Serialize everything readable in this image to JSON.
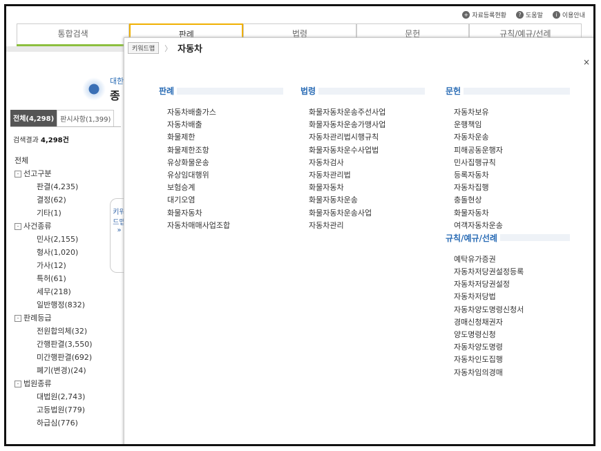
{
  "header": {
    "links": [
      "자료등록현황",
      "도움말",
      "이용안내"
    ]
  },
  "tabs": [
    "통합검색",
    "판례",
    "법령",
    "문헌",
    "규칙/예규/선례"
  ],
  "logo": {
    "line1": "대한",
    "line2": "종"
  },
  "left": {
    "tabs": [
      "전체(4,298)",
      "판시사항(1,399)"
    ],
    "result_label": "검색결과",
    "result_count": "4,298건",
    "tree": [
      {
        "label": "전체",
        "level": 0,
        "toggle": ""
      },
      {
        "label": "선고구분",
        "level": 1,
        "toggle": "-"
      },
      {
        "label": "판결(4,235)",
        "level": 2
      },
      {
        "label": "결정(62)",
        "level": 2
      },
      {
        "label": "기타(1)",
        "level": 2
      },
      {
        "label": "사건종류",
        "level": 1,
        "toggle": "-"
      },
      {
        "label": "민사(2,155)",
        "level": 2
      },
      {
        "label": "형사(1,020)",
        "level": 2
      },
      {
        "label": "가사(12)",
        "level": 2
      },
      {
        "label": "특허(61)",
        "level": 2
      },
      {
        "label": "세무(218)",
        "level": 2
      },
      {
        "label": "일반행정(832)",
        "level": 2
      },
      {
        "label": "판례등급",
        "level": 1,
        "toggle": "-"
      },
      {
        "label": "전원합의체(32)",
        "level": 2
      },
      {
        "label": "간행판결(3,550)",
        "level": 2
      },
      {
        "label": "미간행판결(692)",
        "level": 2
      },
      {
        "label": "폐기(변경)(24)",
        "level": 2
      },
      {
        "label": "법원종류",
        "level": 1,
        "toggle": "-"
      },
      {
        "label": "대법원(2,743)",
        "level": 2
      },
      {
        "label": "고등법원(779)",
        "level": 2
      },
      {
        "label": "하급심(776)",
        "level": 2
      }
    ],
    "side_handle": "키워드맵 »"
  },
  "popup": {
    "breadcrumb": "키워드맵",
    "keyword": "자동차",
    "close": "×",
    "columns": [
      {
        "title": "판례",
        "items": [
          "자동차배출가스",
          "자동차배출",
          "화물제한",
          "화물제한조항",
          "유상화물운송",
          "유상임대행위",
          "보험승계",
          "대기오염",
          "화물자동차",
          "자동차매매사업조합"
        ]
      },
      {
        "title": "법령",
        "items": [
          "화물자동차운송주선사업",
          "화물자동차운송가맹사업",
          "자동차관리법시행규칙",
          "화물자동차운수사업법",
          "자동차검사",
          "자동차관리법",
          "화물자동차",
          "화물자동차운송",
          "화물자동차운송사업",
          "자동차관리"
        ]
      },
      {
        "title": "문헌",
        "items": [
          "자동차보유",
          "운행책임",
          "자동차운송",
          "피해공동운행자",
          "민사집행규칙",
          "등록자동차",
          "자동차집행",
          "충돌현상",
          "화물자동차",
          "여객자동차운송"
        ]
      },
      {
        "title": "규칙/예규/선례",
        "items": [
          "예탁유가증권",
          "자동차저당권설정등록",
          "자동차저당권설정",
          "자동차저당법",
          "자동차양도명령신청서",
          "경매신청채권자",
          "양도명령신청",
          "자동차양도명령",
          "자동차인도집행",
          "자동차임의경매"
        ]
      }
    ]
  }
}
